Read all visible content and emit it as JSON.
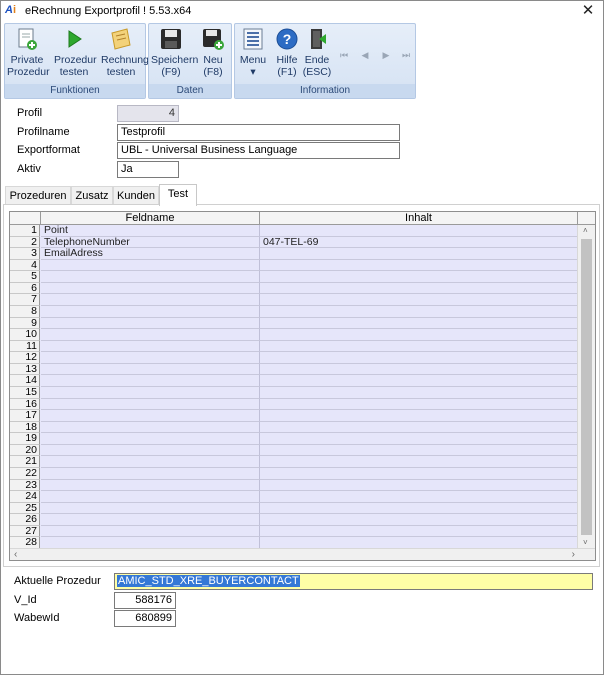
{
  "window": {
    "title": "eRechnung Exportprofil ! 5.53.x64",
    "close": "✕"
  },
  "ribbon": {
    "groups": [
      {
        "label": "Funktionen"
      },
      {
        "label": "Daten"
      },
      {
        "label": "Information"
      }
    ],
    "buttons": {
      "private_prozedur": [
        "Private",
        "Prozedur"
      ],
      "prozedur_testen": [
        "Prozedur",
        "testen"
      ],
      "rechnung_testen": [
        "Rechnung",
        "testen"
      ],
      "speichern": [
        "Speichern",
        "(F9)"
      ],
      "neu": [
        "Neu",
        "(F8)"
      ],
      "menu": [
        "Menu",
        "▾"
      ],
      "hilfe": [
        "Hilfe",
        "(F1)"
      ],
      "ende": [
        "Ende",
        "(ESC)"
      ]
    },
    "nav": [
      "⏮",
      "◀",
      "▶",
      "⏭"
    ]
  },
  "form": {
    "profil_label": "Profil",
    "profil_value": "4",
    "profilname_label": "Profilname",
    "profilname_value": "Testprofil",
    "exportformat_label": "Exportformat",
    "exportformat_value": "UBL - Universal Business Language",
    "aktiv_label": "Aktiv",
    "aktiv_value": "Ja"
  },
  "tabs": [
    {
      "label": "Prozeduren",
      "active": false
    },
    {
      "label": "Zusatz",
      "active": false
    },
    {
      "label": "Kunden",
      "active": false
    },
    {
      "label": "Test",
      "active": true
    }
  ],
  "grid": {
    "columns": [
      "Feldname",
      "Inhalt"
    ],
    "rows": [
      [
        "1",
        "Point",
        ""
      ],
      [
        "2",
        "TelephoneNumber",
        "047-TEL-69"
      ],
      [
        "3",
        "EmailAdress",
        ""
      ],
      [
        "4",
        "",
        ""
      ],
      [
        "5",
        "",
        ""
      ],
      [
        "6",
        "",
        ""
      ],
      [
        "7",
        "",
        ""
      ],
      [
        "8",
        "",
        ""
      ],
      [
        "9",
        "",
        ""
      ],
      [
        "10",
        "",
        ""
      ],
      [
        "11",
        "",
        ""
      ],
      [
        "12",
        "",
        ""
      ],
      [
        "13",
        "",
        ""
      ],
      [
        "14",
        "",
        ""
      ],
      [
        "15",
        "",
        ""
      ],
      [
        "16",
        "",
        ""
      ],
      [
        "17",
        "",
        ""
      ],
      [
        "18",
        "",
        ""
      ],
      [
        "19",
        "",
        ""
      ],
      [
        "20",
        "",
        ""
      ],
      [
        "21",
        "",
        ""
      ],
      [
        "22",
        "",
        ""
      ],
      [
        "23",
        "",
        ""
      ],
      [
        "24",
        "",
        ""
      ],
      [
        "25",
        "",
        ""
      ],
      [
        "26",
        "",
        ""
      ],
      [
        "27",
        "",
        ""
      ],
      [
        "28",
        "",
        ""
      ]
    ],
    "scroll_left": "‹",
    "scroll_right": "›",
    "scroll_up": "˄",
    "scroll_down": "˅"
  },
  "bottom": {
    "aktuelle_prozedur_label": "Aktuelle Prozedur",
    "aktuelle_prozedur_value": "AMIC_STD_XRE_BUYERCONTACT",
    "v_id_label": "V_Id",
    "v_id_value": "588176",
    "wabewid_label": "WabewId",
    "wabewid_value": "680899"
  },
  "colors": {
    "ribbon_bg": "#d5e2f3",
    "grid_bg": "#e6e6fa",
    "highlight_field": "#fefea6",
    "selection": "#3478d6"
  }
}
